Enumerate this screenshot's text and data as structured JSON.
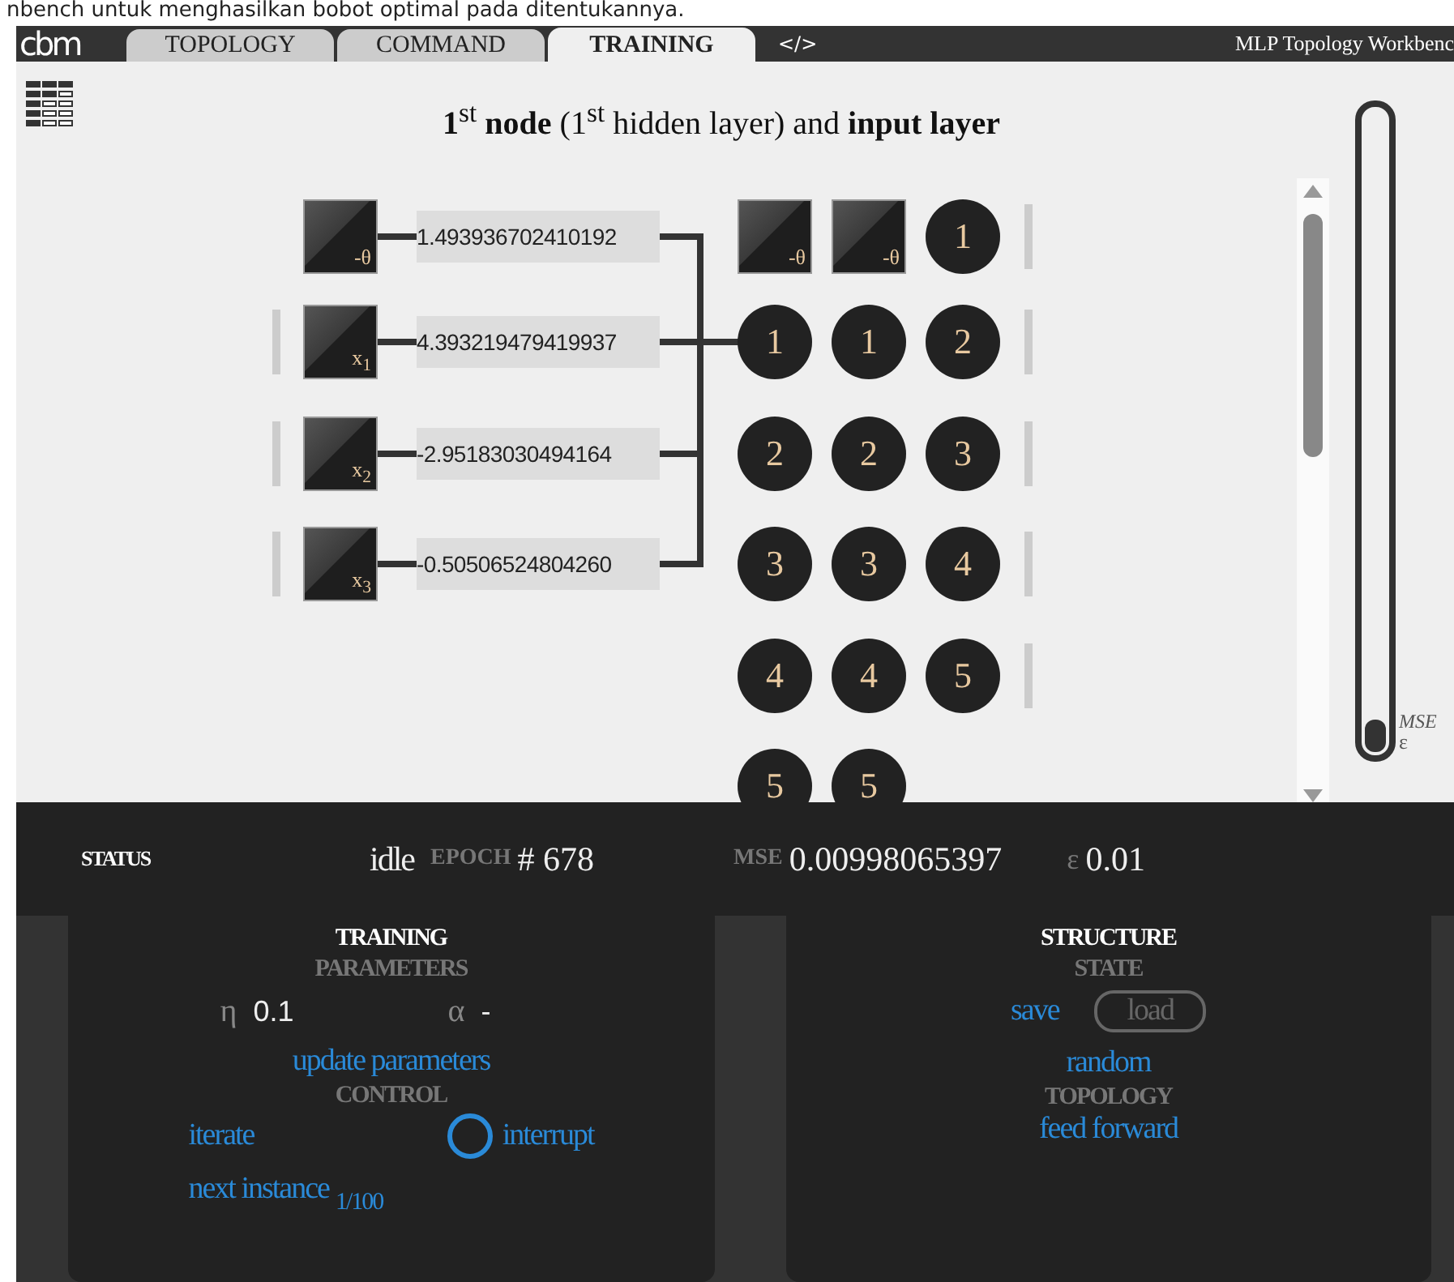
{
  "caption": "nbench untuk menghasilkan bobot optimal pada ditentukannya.",
  "header": {
    "logo": "cbm",
    "tabs": [
      {
        "label": "TOPOLOGY",
        "selected": false
      },
      {
        "label": "COMMAND",
        "selected": false
      },
      {
        "label": "TRAINING",
        "selected": true
      }
    ],
    "code_tab": "</>",
    "app_title": "MLP Topology Workbenc"
  },
  "title": "**1**$^{st}$ **node** (1$^{st}$ hidden layer) and **input layer**",
  "inputs": [
    {
      "kind": "bias",
      "label": "-θ",
      "weight": "1.493936702410192"
    },
    {
      "kind": "input",
      "label": "x$_{1}$",
      "weight": "4.393219479419937"
    },
    {
      "kind": "input",
      "label": "x$_{2}$",
      "weight": "-2.95183030494164"
    },
    {
      "kind": "input",
      "label": "x$_{3}$",
      "weight": "-0.50506524804260"
    }
  ],
  "layers": [
    {
      "nodes": [
        {
          "kind": "bias",
          "label": "-θ"
        },
        {
          "kind": "neuron",
          "label": "1"
        },
        {
          "kind": "neuron",
          "label": "2"
        },
        {
          "kind": "neuron",
          "label": "3"
        },
        {
          "kind": "neuron",
          "label": "4"
        },
        {
          "kind": "neuron",
          "label": "5"
        }
      ]
    },
    {
      "nodes": [
        {
          "kind": "bias",
          "label": "-θ"
        },
        {
          "kind": "neuron",
          "label": "1"
        },
        {
          "kind": "neuron",
          "label": "2"
        },
        {
          "kind": "neuron",
          "label": "3"
        },
        {
          "kind": "neuron",
          "label": "4"
        },
        {
          "kind": "neuron",
          "label": "5"
        }
      ]
    },
    {
      "handles": true,
      "nodes": [
        {
          "kind": "neuron",
          "label": "1"
        },
        {
          "kind": "neuron",
          "label": "2"
        },
        {
          "kind": "neuron",
          "label": "3"
        },
        {
          "kind": "neuron",
          "label": "4"
        },
        {
          "kind": "neuron",
          "label": "5"
        }
      ]
    }
  ],
  "mse_gauge": {
    "level": 0.05,
    "top_label": "MSE",
    "bottom_label": "ε"
  },
  "status": {
    "label": "STATUS",
    "state": "idle",
    "epoch_label": "EPOCH",
    "epoch_value": "# 678",
    "mse_label": "MSE",
    "mse_value": "0.00998065397",
    "epsilon_label": "ε",
    "epsilon_value": "0.01"
  },
  "training": {
    "title": "TRAINING",
    "parameters_heading": "PARAMETERS",
    "params": [
      {
        "symbol": "η",
        "value": "0.1"
      },
      {
        "symbol": "α",
        "value": "-"
      }
    ],
    "update": "update parameters",
    "control_heading": "CONTROL",
    "iterate": "iterate",
    "interrupt": "interrupt",
    "next_instance": "next instance",
    "instance_count": "1/100"
  },
  "structure": {
    "title": "STRUCTURE",
    "state_heading": "STATE",
    "save": "save",
    "load": {
      "label": "load",
      "disabled": true
    },
    "random": "random",
    "topology_heading": "TOPOLOGY",
    "topology": "feed forward"
  }
}
